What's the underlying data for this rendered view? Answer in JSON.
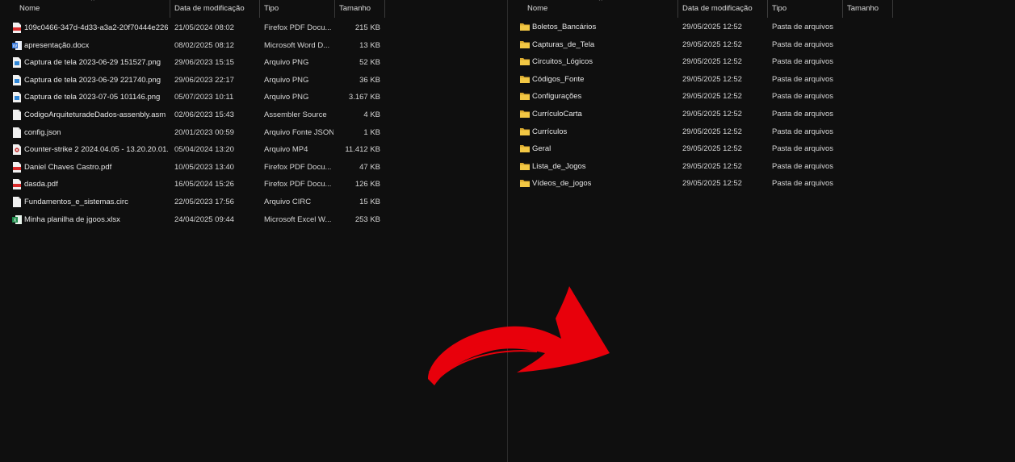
{
  "left_pane": {
    "columns": {
      "name": "Nome",
      "date": "Data de modificação",
      "type": "Tipo",
      "size": "Tamanho"
    },
    "files": [
      {
        "name": "109c0466-347d-4d33-a3a2-20f70444e226....",
        "date": "21/05/2024 08:02",
        "type": "Firefox PDF Docu...",
        "size": "215 KB",
        "icon": "pdf-icon"
      },
      {
        "name": "apresentação.docx",
        "date": "08/02/2025 08:12",
        "type": "Microsoft Word D...",
        "size": "13 KB",
        "icon": "word-icon"
      },
      {
        "name": "Captura de tela 2023-06-29 151527.png",
        "date": "29/06/2023 15:15",
        "type": "Arquivo PNG",
        "size": "52 KB",
        "icon": "image-icon"
      },
      {
        "name": "Captura de tela 2023-06-29 221740.png",
        "date": "29/06/2023 22:17",
        "type": "Arquivo PNG",
        "size": "36 KB",
        "icon": "image-icon"
      },
      {
        "name": "Captura de tela 2023-07-05 101146.png",
        "date": "05/07/2023 10:11",
        "type": "Arquivo PNG",
        "size": "3.167 KB",
        "icon": "image-icon"
      },
      {
        "name": "CodigoArquiteturadeDados-assenbly.asm",
        "date": "02/06/2023 15:43",
        "type": "Assembler Source",
        "size": "4 KB",
        "icon": "file-icon"
      },
      {
        "name": "config.json",
        "date": "20/01/2023 00:59",
        "type": "Arquivo Fonte JSON",
        "size": "1 KB",
        "icon": "file-icon"
      },
      {
        "name": "Counter-strike 2 2024.04.05 - 13.20.20.01....",
        "date": "05/04/2024 13:20",
        "type": "Arquivo MP4",
        "size": "11.412 KB",
        "icon": "video-icon"
      },
      {
        "name": "Daniel Chaves Castro.pdf",
        "date": "10/05/2023 13:40",
        "type": "Firefox PDF Docu...",
        "size": "47 KB",
        "icon": "pdf-icon"
      },
      {
        "name": "dasda.pdf",
        "date": "16/05/2024 15:26",
        "type": "Firefox PDF Docu...",
        "size": "126 KB",
        "icon": "pdf-icon"
      },
      {
        "name": "Fundamentos_e_sistemas.circ",
        "date": "22/05/2023 17:56",
        "type": "Arquivo CIRC",
        "size": "15 KB",
        "icon": "file-icon"
      },
      {
        "name": "Minha planilha de jgoos.xlsx",
        "date": "24/04/2025 09:44",
        "type": "Microsoft Excel W...",
        "size": "253 KB",
        "icon": "excel-icon"
      }
    ]
  },
  "right_pane": {
    "columns": {
      "name": "Nome",
      "date": "Data de modificação",
      "type": "Tipo",
      "size": "Tamanho"
    },
    "folders": [
      {
        "name": "Boletos_Bancários",
        "date": "29/05/2025 12:52",
        "type": "Pasta de arquivos"
      },
      {
        "name": "Capturas_de_Tela",
        "date": "29/05/2025 12:52",
        "type": "Pasta de arquivos"
      },
      {
        "name": "Circuitos_Lógicos",
        "date": "29/05/2025 12:52",
        "type": "Pasta de arquivos"
      },
      {
        "name": "Códigos_Fonte",
        "date": "29/05/2025 12:52",
        "type": "Pasta de arquivos"
      },
      {
        "name": "Configurações",
        "date": "29/05/2025 12:52",
        "type": "Pasta de arquivos"
      },
      {
        "name": "CurrículoCarta",
        "date": "29/05/2025 12:52",
        "type": "Pasta de arquivos"
      },
      {
        "name": "Currículos",
        "date": "29/05/2025 12:52",
        "type": "Pasta de arquivos"
      },
      {
        "name": "Geral",
        "date": "29/05/2025 12:52",
        "type": "Pasta de arquivos"
      },
      {
        "name": "Lista_de_Jogos",
        "date": "29/05/2025 12:52",
        "type": "Pasta de arquivos"
      },
      {
        "name": "Vídeos_de_jogos",
        "date": "29/05/2025 12:52",
        "type": "Pasta de arquivos"
      }
    ]
  },
  "annotation": {
    "arrow_color": "#e8000b",
    "arrow_icon": "curved-arrow-icon"
  },
  "colors": {
    "background": "#0f0f0f",
    "folder": "#f2c744",
    "pdf": "#d82b2b",
    "word": "#2b6fd6",
    "excel": "#1d8a4a"
  }
}
